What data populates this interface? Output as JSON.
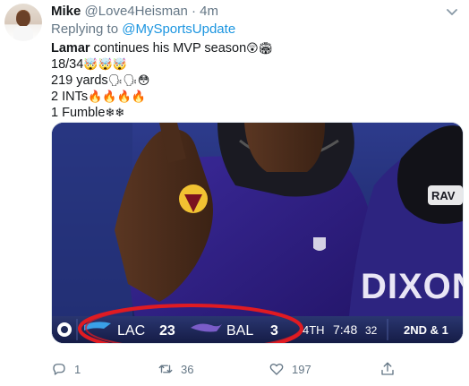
{
  "tweet": {
    "author_name": "Mike",
    "handle_time": "@Love4Heisman · 4m",
    "replying_prefix": "Replying to ",
    "replying_to": "@MySportsUpdate",
    "lines": [
      {
        "bold": "Lamar",
        "text": " continues his MVP season",
        "emoji": "😲🏟"
      },
      {
        "bold": "",
        "text": "18/34",
        "emoji": "🤯🤯🤯"
      },
      {
        "bold": "",
        "text": "219 yards",
        "emoji": "🗣🗣😳"
      },
      {
        "bold": "",
        "text": "2 INTs",
        "emoji": "🔥🔥🔥🔥"
      },
      {
        "bold": "",
        "text": "1 Fumble",
        "emoji": "❄❄"
      }
    ]
  },
  "media": {
    "jersey_text": "DIXON",
    "helmet_text": "RAV",
    "scoreboard": {
      "team_away": "LAC",
      "score_away": "23",
      "team_home": "BAL",
      "score_home": "3",
      "quarter": "4TH",
      "clock": "7:48",
      "play_clock": "32",
      "down_distance": "2ND & 1"
    },
    "colors": {
      "scorebar": "#1f2a57",
      "ravens_purple": "#2a1f6b",
      "circle": "#e01b22"
    }
  },
  "actions": {
    "reply_count": "1",
    "retweet_count": "36",
    "like_count": "197",
    "share_count": ""
  },
  "icons": {
    "caret": "chevron-down-icon",
    "reply": "reply-icon",
    "retweet": "retweet-icon",
    "like": "heart-icon",
    "share": "share-icon"
  }
}
